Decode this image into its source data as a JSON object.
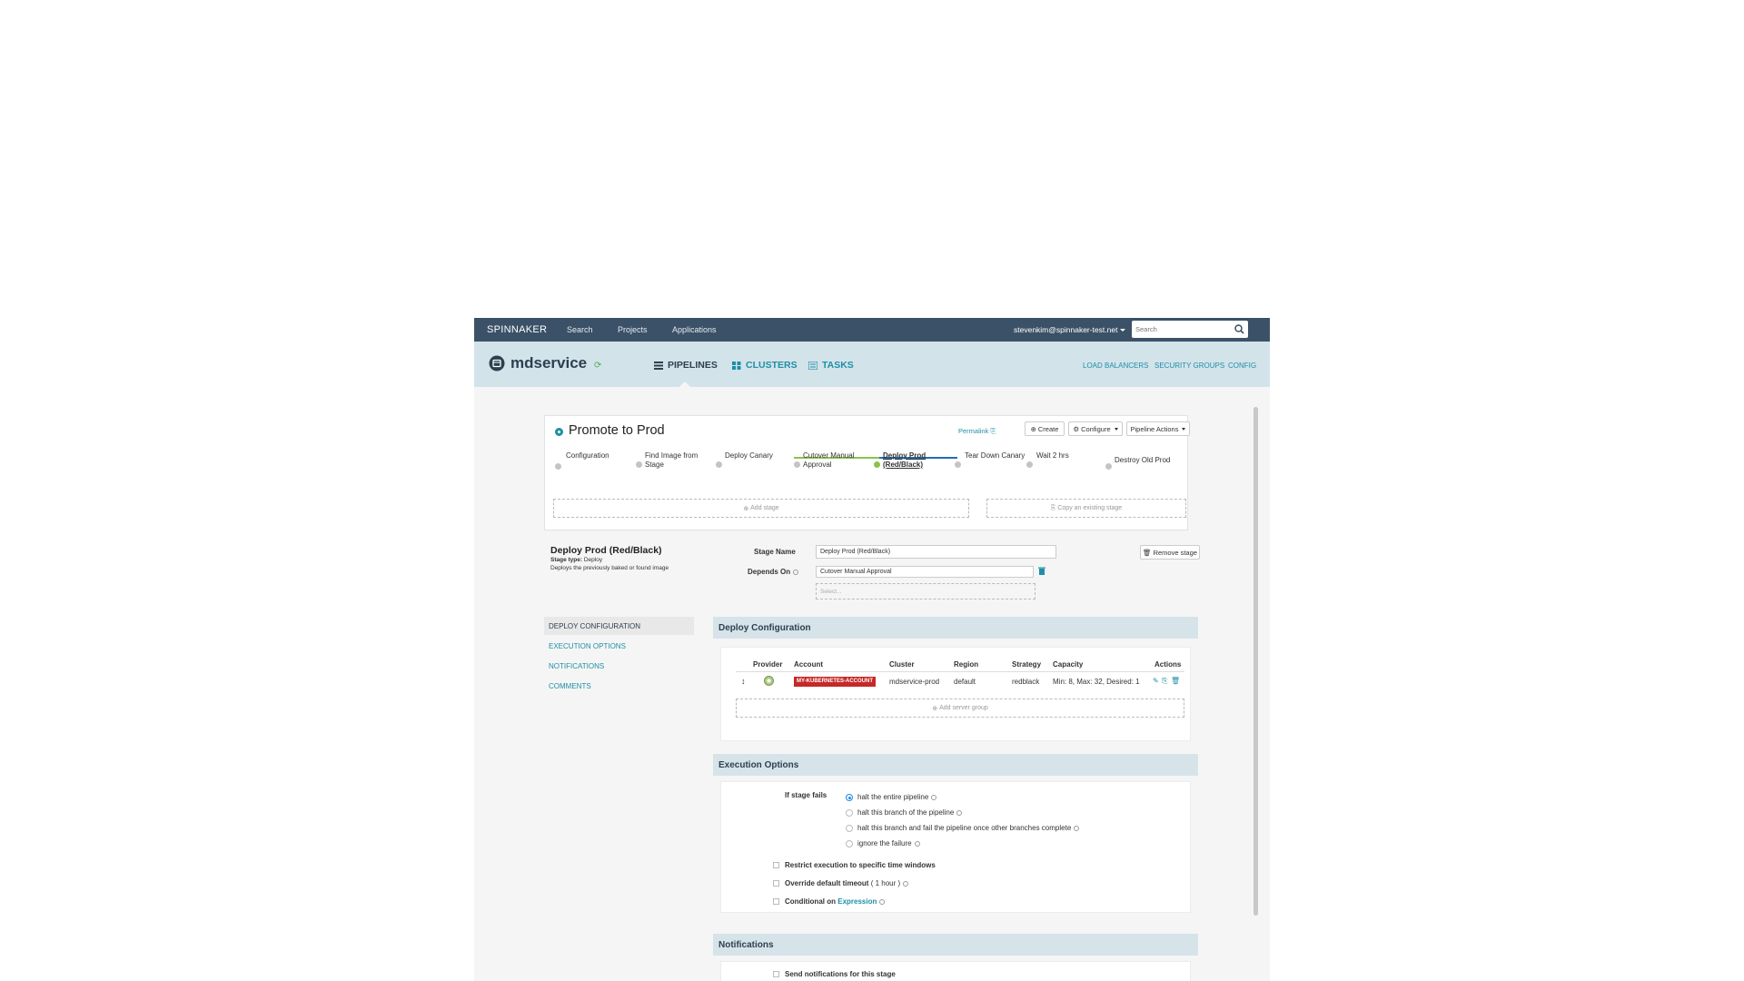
{
  "topbar": {
    "brand": "SPINNAKER",
    "nav": [
      "Search",
      "Projects",
      "Applications"
    ],
    "user": "stevenkim@spinnaker-test.net",
    "search_placeholder": "Search"
  },
  "app_header": {
    "app_name": "mdservice",
    "tabs": [
      "PIPELINES",
      "CLUSTERS",
      "TASKS"
    ],
    "right_links": [
      "LOAD BALANCERS",
      "SECURITY GROUPS",
      "CONFIG"
    ]
  },
  "pipeline": {
    "title": "Promote to Prod",
    "permalink": "Permalink",
    "buttons": {
      "create": "Create",
      "configure": "Configure",
      "actions": "Pipeline Actions"
    },
    "stages": [
      {
        "line1": "Configuration",
        "line2": ""
      },
      {
        "line1": "Find Image from",
        "line2": "Stage"
      },
      {
        "line1": "Deploy Canary",
        "line2": ""
      },
      {
        "line1": "Cutover Manual",
        "line2": "Approval"
      },
      {
        "line1": "Deploy Prod",
        "line2": "(Red/Black)"
      },
      {
        "line1": "Tear Down Canary",
        "line2": ""
      },
      {
        "line1": "Wait 2 hrs",
        "line2": ""
      },
      {
        "line1": "Destroy Old Prod",
        "line2": ""
      }
    ],
    "add_stage": "Add stage",
    "copy_stage": "Copy an existing stage"
  },
  "stage_config": {
    "title": "Deploy Prod (Red/Black)",
    "type_label": "Stage type:",
    "type_value": "Deploy",
    "description": "Deploys the previously baked or found image",
    "stage_name_label": "Stage Name",
    "stage_name_value": "Deploy Prod (Red/Black)",
    "depends_on_label": "Depends On",
    "depends_on_value": "Cutover Manual Approval",
    "select_placeholder": "Select...",
    "remove_stage": "Remove stage"
  },
  "left_nav": [
    "DEPLOY CONFIGURATION",
    "EXECUTION OPTIONS",
    "NOTIFICATIONS",
    "COMMENTS"
  ],
  "deploy_config": {
    "header": "Deploy Configuration",
    "columns": [
      "Provider",
      "Account",
      "Cluster",
      "Region",
      "Strategy",
      "Capacity",
      "Actions"
    ],
    "row": {
      "account": "MY-KUBERNETES-ACCOUNT",
      "cluster": "mdservice-prod",
      "region": "default",
      "strategy": "redblack",
      "capacity": "Min: 8, Max: 32, Desired: 1"
    },
    "add_server_group": "Add server group"
  },
  "execution_options": {
    "header": "Execution Options",
    "if_fails_label": "If stage fails",
    "radio_options": [
      "halt the entire pipeline",
      "halt this branch of the pipeline",
      "halt this branch and fail the pipeline once other branches complete",
      "ignore the failure"
    ],
    "restrict_label": "Restrict execution to specific time windows",
    "timeout_label": "Override default timeout",
    "timeout_hint": "( 1 hour )",
    "conditional_label": "Conditional on",
    "conditional_link": "Expression"
  },
  "notifications": {
    "header": "Notifications",
    "send_label": "Send notifications for this stage"
  },
  "colors": {
    "nav_bg": "#3b5167",
    "header_bg": "#d3e3ea",
    "accent": "#1e8fa6",
    "badge_red": "#c62828"
  }
}
